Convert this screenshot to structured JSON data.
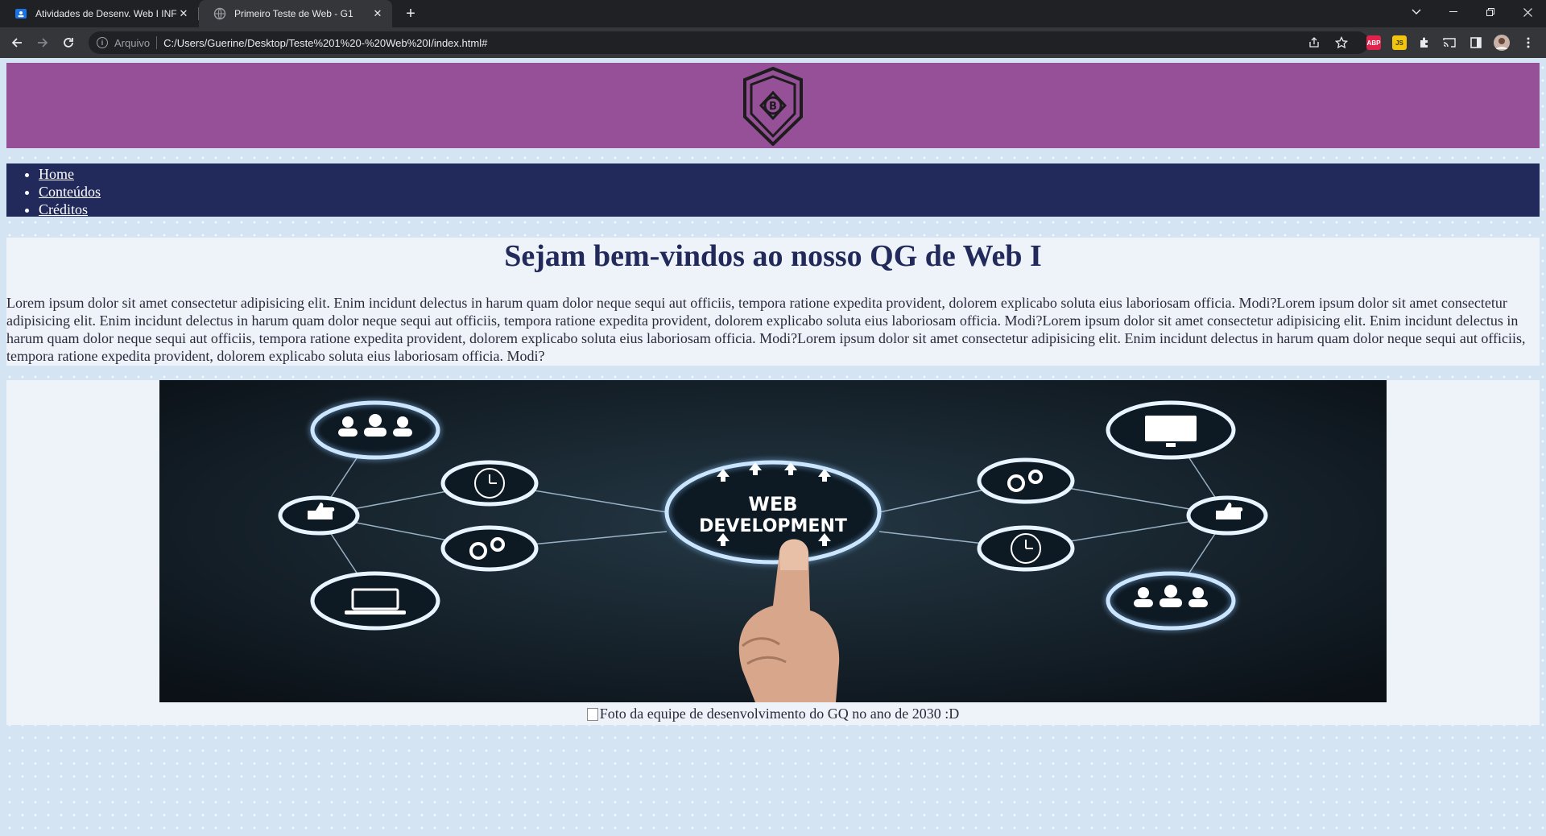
{
  "browser": {
    "tabs": [
      {
        "title": "Atividades de Desenv. Web I INFO",
        "active": false
      },
      {
        "title": "Primeiro Teste de Web - G1",
        "active": true
      }
    ],
    "security_label": "Arquivo",
    "url": "C:/Users/Guerine/Desktop/Teste%201%20-%20Web%20I/index.html#",
    "extensions": [
      {
        "name": "adblock-plus-icon",
        "label": "ABP",
        "color": "#e0234c"
      },
      {
        "name": "javascript-toggle-icon",
        "label": "JS",
        "color": "#f1c40f"
      }
    ]
  },
  "page": {
    "colors": {
      "header": "#955097",
      "nav": "#212a5a",
      "background": "#d5e4f2",
      "panel": "#eef2f9"
    },
    "logo_letter": "B",
    "nav": {
      "items": [
        {
          "label": "Home"
        },
        {
          "label": "Conteúdos"
        },
        {
          "label": "Créditos"
        }
      ]
    },
    "heading": "Sejam bem-vindos ao nosso QG de Web I",
    "paragraph": "Lorem ipsum dolor sit amet consectetur adipisicing elit. Enim incidunt delectus in harum quam dolor neque sequi aut officiis, tempora ratione expedita provident, dolorem explicabo soluta eius laboriosam officia. Modi?Lorem ipsum dolor sit amet consectetur adipisicing elit. Enim incidunt delectus in harum quam dolor neque sequi aut officiis, tempora ratione expedita provident, dolorem explicabo soluta eius laboriosam officia. Modi?Lorem ipsum dolor sit amet consectetur adipisicing elit. Enim incidunt delectus in harum quam dolor neque sequi aut officiis, tempora ratione expedita provident, dolorem explicabo soluta eius laboriosam officia. Modi?Lorem ipsum dolor sit amet consectetur adipisicing elit. Enim incidunt delectus in harum quam dolor neque sequi aut officiis, tempora ratione expedita provident, dolorem explicabo soluta eius laboriosam officia. Modi?",
    "hero": {
      "line1": "WEB",
      "line2": "DEVELOPMENT"
    },
    "caption": "Foto da equipe de desenvolvimento do GQ no ano de 2030 :D"
  }
}
